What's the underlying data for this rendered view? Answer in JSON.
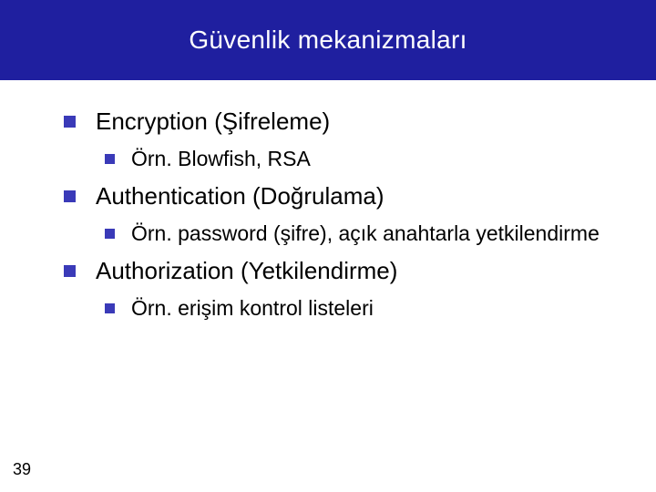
{
  "slide": {
    "title": "Güvenlik mekanizmaları",
    "page_number": "39",
    "items": [
      {
        "label": "Encryption (Şifreleme)",
        "sub": [
          {
            "label": "Örn. Blowfish, RSA"
          }
        ]
      },
      {
        "label": "Authentication (Doğrulama)",
        "sub": [
          {
            "label": "Örn. password (şifre), açık anahtarla yetkilendirme"
          }
        ]
      },
      {
        "label": "Authorization (Yetkilendirme)",
        "sub": [
          {
            "label": "Örn. erişim kontrol listeleri"
          }
        ]
      }
    ]
  }
}
